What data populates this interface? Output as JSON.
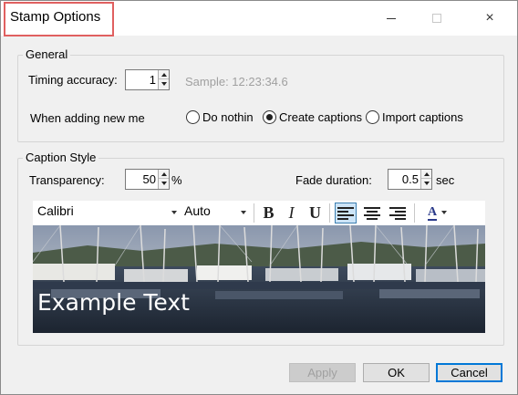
{
  "window": {
    "title": "Stamp Options",
    "controls": {
      "minimize": "minimize-icon",
      "maximize": "maximize-icon",
      "close": "×"
    }
  },
  "general": {
    "legend": "General",
    "timing_label": "Timing accuracy:",
    "timing_value": "1",
    "sample_text": "Sample: 12:23:34.6",
    "adding_label": "When adding new me",
    "radios": [
      {
        "label": "Do nothin",
        "checked": false
      },
      {
        "label": "Create captions",
        "checked": true
      },
      {
        "label": "Import captions",
        "checked": false
      }
    ]
  },
  "caption_style": {
    "legend": "Caption Style",
    "transparency_label": "Transparency:",
    "transparency_value": "50",
    "transparency_unit": "%",
    "fade_label": "Fade duration:",
    "fade_value": "0.5",
    "fade_unit": "sec",
    "toolbar": {
      "font": "Calibri",
      "size": "Auto",
      "bold": "B",
      "italic": "I",
      "underline": "U",
      "color_glyph": "A",
      "alignment_selected": "left"
    },
    "preview_text": "Example Text"
  },
  "footer": {
    "apply": "Apply",
    "ok": "OK",
    "cancel": "Cancel"
  },
  "colors": {
    "accent": "#0078d7",
    "title_highlight": "#e06060",
    "selected_align_bg": "#cce4f7"
  }
}
